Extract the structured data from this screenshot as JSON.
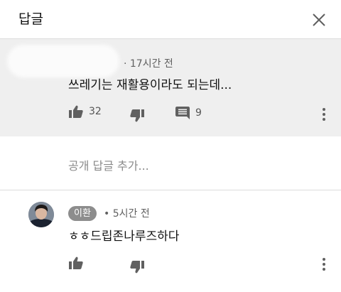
{
  "header": {
    "title": "답글"
  },
  "parent_comment": {
    "timestamp": "· 17시간 전",
    "text": "쓰레기는 재활용이라도 되는데...",
    "like_count": "32",
    "reply_count": "9"
  },
  "reply_input": {
    "placeholder": "공개 답글 추가..."
  },
  "reply": {
    "author": "이환",
    "timestamp": "• 5시간 전",
    "text": "ㅎㅎ드립존나루즈하다"
  },
  "colors": {
    "icon": "#606060",
    "parent_background": "#efefef",
    "author_pill": "#8d8d8d"
  }
}
